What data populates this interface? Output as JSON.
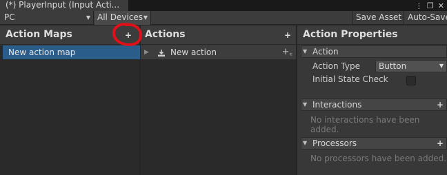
{
  "window": {
    "tab_title": "(*) PlayerInput (Input Acti..."
  },
  "toolbar": {
    "control_scheme": "PC",
    "device": "All Devices",
    "save_asset": "Save Asset",
    "auto_save": "Auto-Save"
  },
  "action_maps": {
    "title": "Action Maps",
    "add_label": "+",
    "items": [
      {
        "label": "New action map"
      }
    ]
  },
  "actions": {
    "title": "Actions",
    "add_label": "+",
    "items": [
      {
        "label": "New action",
        "icon": "download-icon"
      }
    ]
  },
  "properties": {
    "title": "Action Properties",
    "action_section": "Action",
    "action_type_label": "Action Type",
    "action_type_value": "Button",
    "initial_state_label": "Initial State Check",
    "interactions_section": "Interactions",
    "interactions_empty": "No interactions have been added.",
    "processors_section": "Processors",
    "processors_empty": "No processors have been added."
  },
  "colors": {
    "selection": "#2b5d8a",
    "annotation_circle": "#e0101a"
  }
}
